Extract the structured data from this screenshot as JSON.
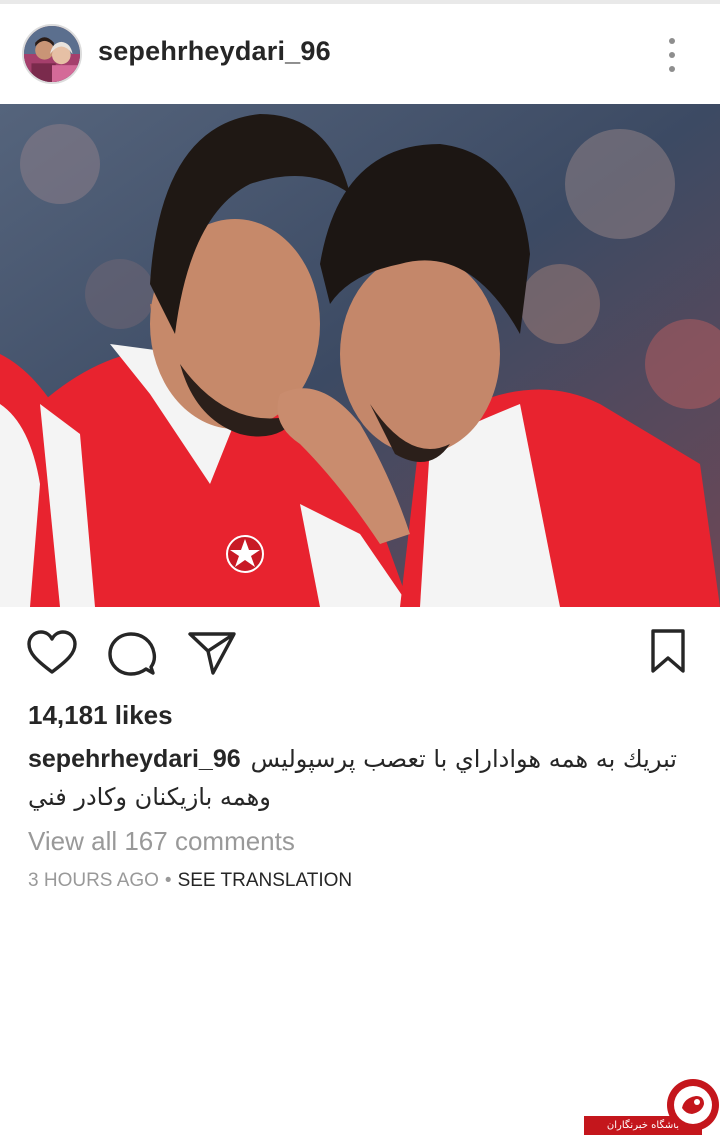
{
  "post": {
    "username": "sepehrheydari_96",
    "likes_text": "14,181 likes",
    "caption": {
      "username": "sepehrheydari_96",
      "text": "تبريك به همه هواداراي با تعصب پرسپوليس وهمه بازيكنان وكادر فني"
    },
    "view_comments": "View all 167 comments",
    "time_ago": "3 HOURS AGO",
    "separator": "•",
    "see_translation": "SEE TRANSLATION"
  },
  "photo": {
    "kit_colors": {
      "red": "#e8232f",
      "white": "#f4f4f4"
    }
  },
  "icons": {
    "more": "more-vertical-icon",
    "like": "heart-icon",
    "comment": "comment-bubble-icon",
    "share": "paper-plane-icon",
    "save": "bookmark-icon"
  },
  "watermark": {
    "text": "باشگاه خبرنگاران",
    "color": "#c4161c"
  }
}
